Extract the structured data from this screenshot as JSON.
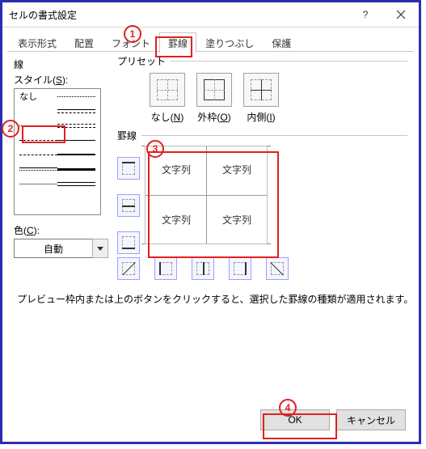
{
  "window": {
    "title": "セルの書式設定"
  },
  "tabs": {
    "t1": "表示形式",
    "t2": "配置",
    "t3": "フォント",
    "t4": "罫線",
    "t5": "塗りつぶし",
    "t6": "保護"
  },
  "line": {
    "section": "線",
    "style_label": "スタイル(",
    "style_key": "S",
    "style_label_after": "):",
    "none": "なし",
    "color_label": "色(",
    "color_key": "C",
    "color_label_after": "):",
    "color_value": "自動"
  },
  "preset": {
    "section": "プリセット",
    "none": "なし(",
    "none_key": "N",
    "outside": "外枠(",
    "outside_key": "O",
    "inside": "内側(",
    "inside_key": "I",
    "close": ")"
  },
  "border": {
    "section": "罫線",
    "cell_text": "文字列"
  },
  "hint": "プレビュー枠内または上のボタンをクリックすると、選択した罫線の種類が適用されます。",
  "buttons": {
    "ok": "OK",
    "cancel": "キャンセル"
  },
  "annot": {
    "n1": "1",
    "n2": "2",
    "n3": "3",
    "n4": "4"
  }
}
